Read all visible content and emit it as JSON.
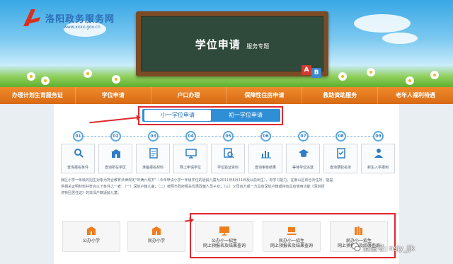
{
  "header": {
    "logo_name": "洛阳政务服务网",
    "logo_url": "www.xxxx.gov.cn",
    "board_title": "学位申请",
    "board_subtitle": "服务专题"
  },
  "nav": {
    "items": [
      "办理计划生育服务证",
      "学位申请",
      "户口办理",
      "保障性住房申请",
      "救助资助服务",
      "老年人福利待遇"
    ]
  },
  "tabs": {
    "active": "小一学位申请",
    "inactive": "初一学位申请"
  },
  "steps": [
    {
      "num": "01",
      "label": "查询报名条件",
      "icon": "search-icon"
    },
    {
      "num": "02",
      "label": "查询所在学区",
      "icon": "school-icon"
    },
    {
      "num": "03",
      "label": "准备报名材料",
      "icon": "document-icon"
    },
    {
      "num": "04",
      "label": "网上申请学位",
      "icon": "monitor-icon"
    },
    {
      "num": "05",
      "label": "学位验证资料",
      "icon": "verify-icon"
    },
    {
      "num": "06",
      "label": "查询审核结果",
      "icon": "chart-icon"
    },
    {
      "num": "07",
      "label": "等待学位派送",
      "icon": "graduation-cap-icon"
    },
    {
      "num": "08",
      "label": "查询录取名单",
      "icon": "checklist-icon"
    },
    {
      "num": "09",
      "label": "新生入学报到",
      "icon": "student-icon"
    }
  ],
  "notice": {
    "line1": "我区小学一年级的招生对象为符合教育法律规定\"年满六周岁\"（今年申请小学一年级学位的适龄儿童为2011年8月31日及以前出生），有学习能力，在南山区有合法住所，能提",
    "line2": "供相关证明材料并符合以下条件之一者：（一）深圳户籍儿童；（二）按照市政府相关优惠政策人员子女；（三）父母双方或一方具有深圳户籍或持有具有使用功能《深圳经",
    "line3": "济特区居住证》的非深户籍适龄儿童。"
  },
  "cards": [
    {
      "label": "公办小学",
      "label2": "",
      "icon": "school-building-icon"
    },
    {
      "label": "民办小学",
      "label2": "",
      "icon": "school-building-icon"
    },
    {
      "label": "公办小一招生",
      "label2": "网上预报名及结果查询",
      "icon": "monitor-icon"
    },
    {
      "label": "民办小一招生",
      "label2": "网上预报名及结果查询",
      "icon": "laptop-icon"
    },
    {
      "label": "民办小一招生",
      "label2": "网上预报名及结果查询",
      "icon": "books-icon"
    }
  ],
  "watermark": {
    "text": "微信号: nsjy_jjk"
  },
  "colors": {
    "nav": "#e8791f",
    "accent_blue": "#2e8fd6",
    "highlight_red": "#e0282c"
  }
}
